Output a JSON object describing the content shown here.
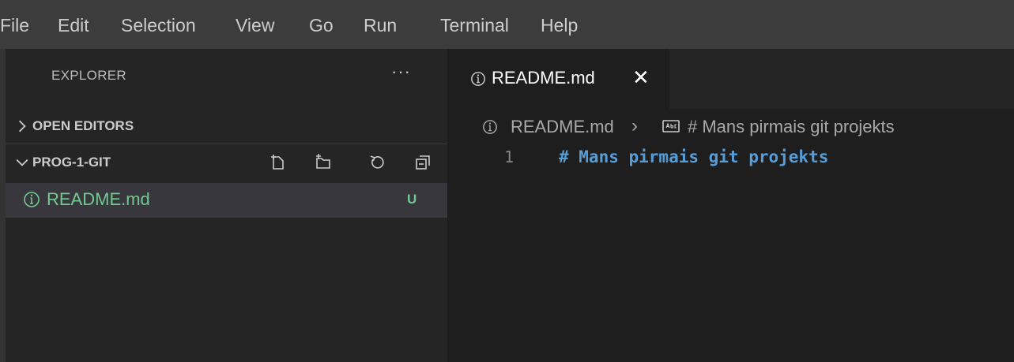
{
  "menu": [
    "File",
    "Edit",
    "Selection",
    "View",
    "Go",
    "Run",
    "Terminal",
    "Help"
  ],
  "sidebar": {
    "title": "EXPLORER",
    "more_actions": "···",
    "sections": [
      {
        "label": "OPEN EDITORS",
        "expanded": false
      },
      {
        "label": "PROG-1-GIT",
        "expanded": true
      }
    ],
    "section_actions": [
      "new-file-icon",
      "new-folder-icon",
      "refresh-icon",
      "collapse-all-icon"
    ],
    "files": [
      {
        "name": "README.md",
        "status": "U",
        "icon": "info-icon"
      }
    ]
  },
  "editor": {
    "tab": {
      "label": "README.md",
      "close": "✕",
      "icon": "info-icon"
    },
    "breadcrumb": {
      "file": "README.md",
      "separator": "›",
      "heading": "# Mans pirmais git projekts"
    },
    "lines": [
      {
        "number": "1",
        "text": "# Mans pirmais git projekts"
      }
    ]
  },
  "colors": {
    "menubar_bg": "#3c3c3c",
    "sidebar_bg": "#252526",
    "editor_bg": "#1e1e1e",
    "selected_row_bg": "#37373d",
    "untracked_green": "#73c991",
    "heading_blue": "#569cd6"
  }
}
